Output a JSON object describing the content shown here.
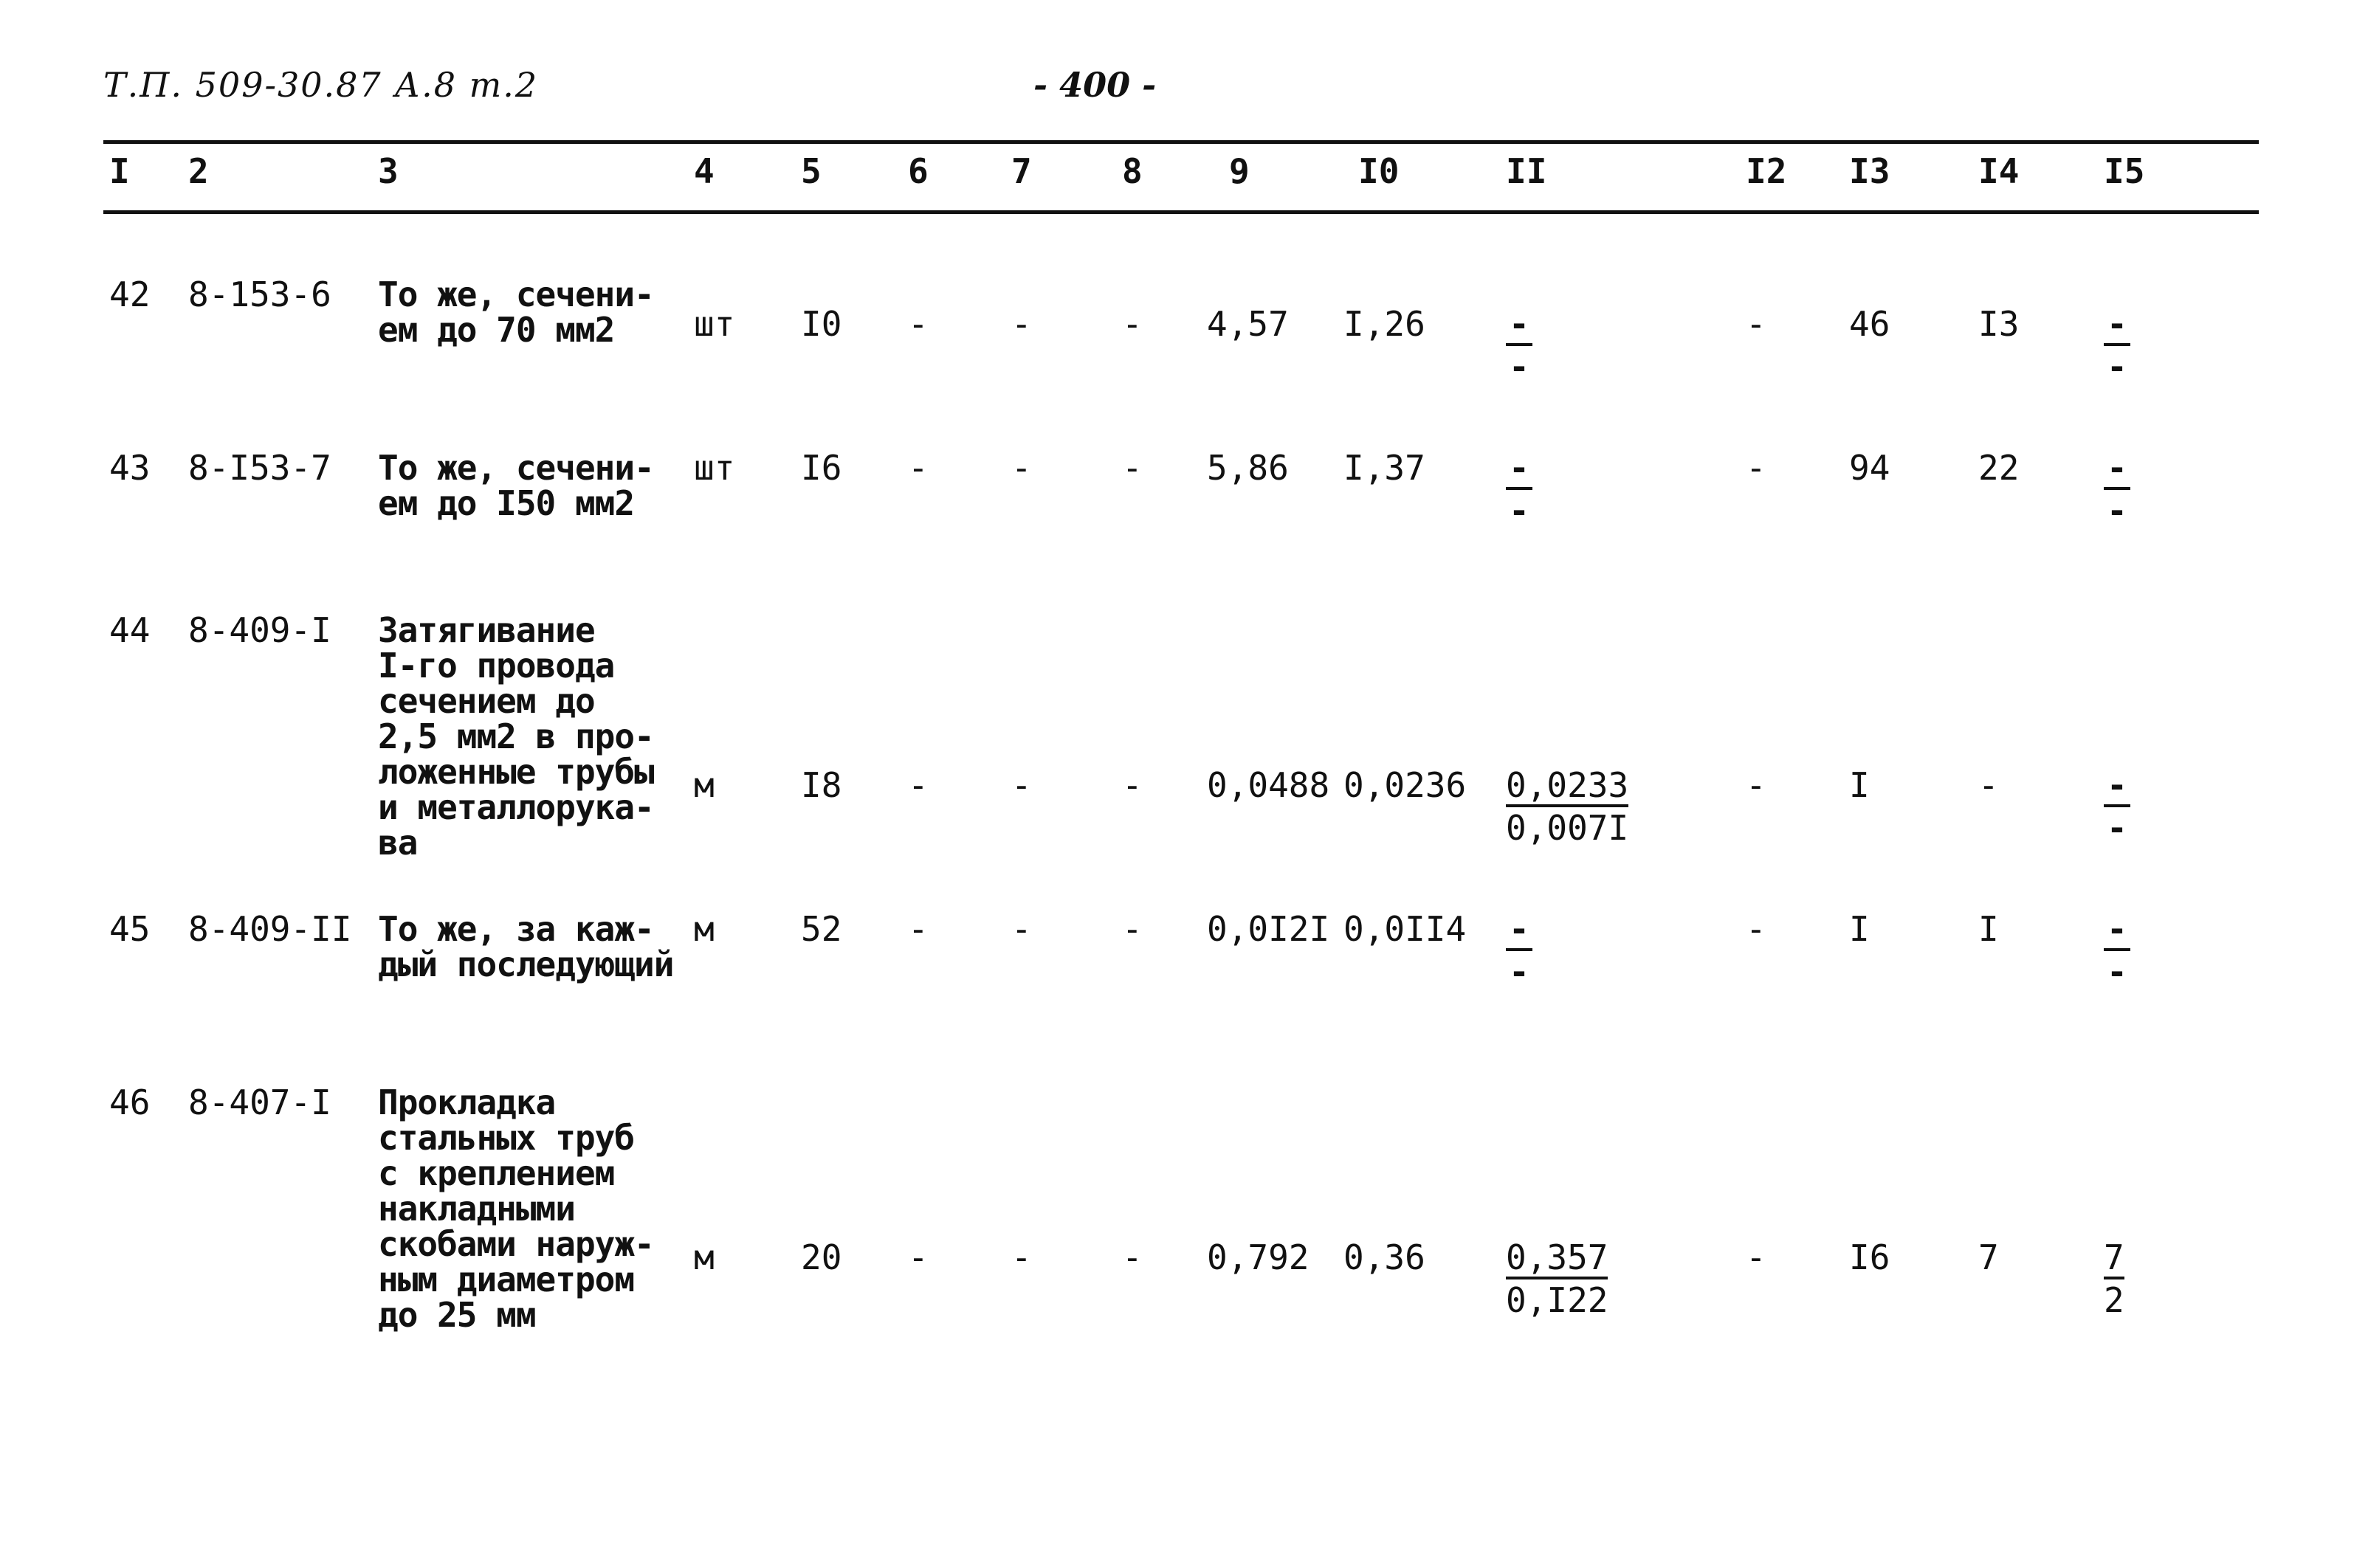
{
  "header": {
    "doc_ref": "Т.П. 509-30.87  А.8 т.2",
    "page_number": "- 400 -"
  },
  "columns": [
    "I",
    "2",
    "3",
    "4",
    "5",
    "6",
    "7",
    "8",
    "9",
    "I0",
    "II",
    "I2",
    "I3",
    "I4",
    "I5"
  ],
  "rows": [
    {
      "no": "42",
      "code": "8-153-6",
      "description": "То же, сечени-\nем до 70 мм2",
      "unit": "шт",
      "qty": "I0",
      "c6": "-",
      "c7": "-",
      "c8": "-",
      "c9": "4,57",
      "c10": "I,26",
      "c11": {
        "num": "-",
        "den": "-"
      },
      "c12": "-",
      "c13": "46",
      "c14": "I3",
      "c15": {
        "num": "-",
        "den": "-"
      }
    },
    {
      "no": "43",
      "code": "8-I53-7",
      "description": "То же, сечени-\nем до I50 мм2",
      "unit": "шт",
      "qty": "I6",
      "c6": "-",
      "c7": "-",
      "c8": "-",
      "c9": "5,86",
      "c10": "I,37",
      "c11": {
        "num": "-",
        "den": "-"
      },
      "c12": "-",
      "c13": "94",
      "c14": "22",
      "c15": {
        "num": "-",
        "den": "-"
      }
    },
    {
      "no": "44",
      "code": "8-409-I",
      "description": "Затягивание\nI-го провода\nсечением до\n2,5 мм2 в про-\nложенные трубы\nи металлорука-\nва",
      "unit": "м",
      "qty": "I8",
      "c6": "-",
      "c7": "-",
      "c8": "-",
      "c9": "0,0488",
      "c10": "0,0236",
      "c11": {
        "num": "0,0233",
        "den": "0,007I"
      },
      "c12": "-",
      "c13": "I",
      "c14": "-",
      "c15": {
        "num": "-",
        "den": "-"
      }
    },
    {
      "no": "45",
      "code": "8-409-II",
      "description": "То же, за каж-\nдый последующий",
      "unit": "м",
      "qty": "52",
      "c6": "-",
      "c7": "-",
      "c8": "-",
      "c9": "0,0I2I",
      "c10": "0,0II4",
      "c11": {
        "num": "-",
        "den": "-"
      },
      "c12": "-",
      "c13": "I",
      "c14": "I",
      "c15": {
        "num": "-",
        "den": "-"
      }
    },
    {
      "no": "46",
      "code": "8-407-I",
      "description": "Прокладка\nстальных труб\nс креплением\nнакладными\nскобами наруж-\nным диаметром\nдо 25 мм",
      "unit": "м",
      "qty": "20",
      "c6": "-",
      "c7": "-",
      "c8": "-",
      "c9": "0,792",
      "c10": "0,36",
      "c11": {
        "num": "0,357",
        "den": "0,I22"
      },
      "c12": "-",
      "c13": "I6",
      "c14": "7",
      "c15": {
        "num": "7",
        "den": "2"
      }
    }
  ]
}
